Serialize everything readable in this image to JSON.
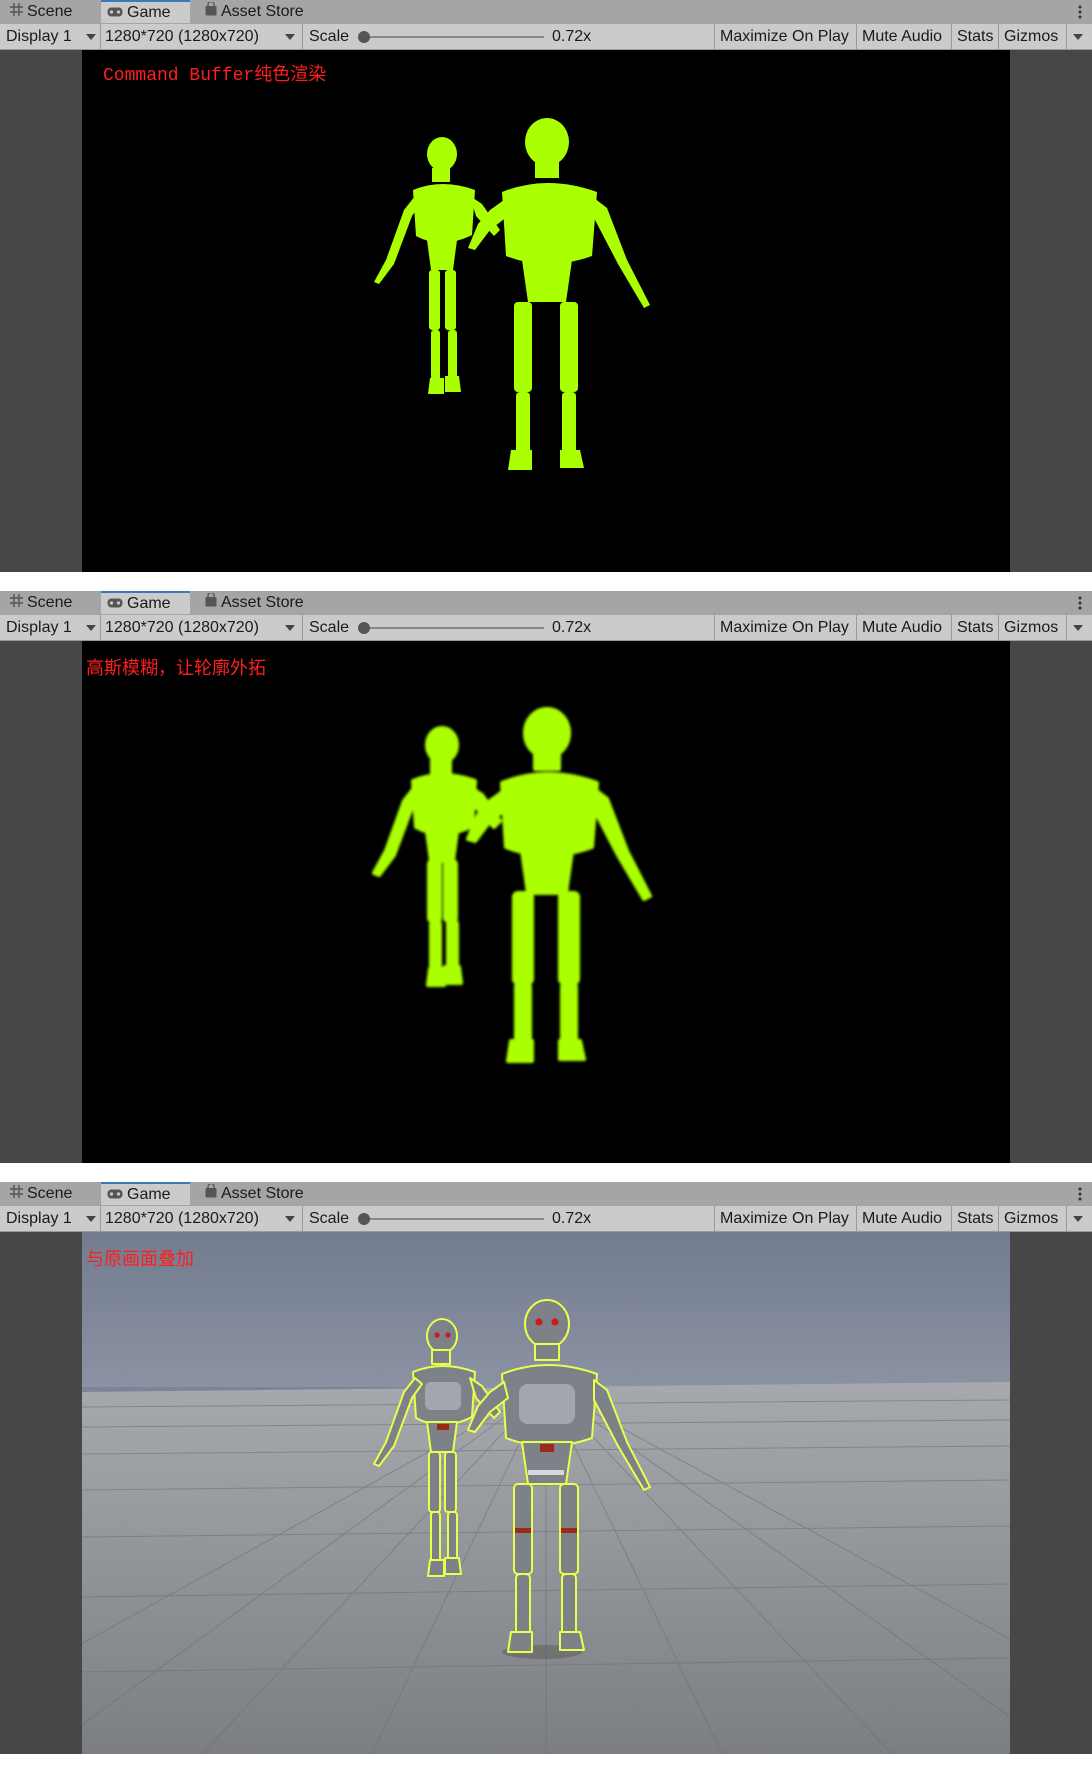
{
  "tabs": {
    "scene": "Scene",
    "game": "Game",
    "asset_store": "Asset Store"
  },
  "toolbar": {
    "display": "Display 1",
    "resolution": "1280*720 (1280x720)",
    "scale_label": "Scale",
    "scale_value": "0.72x",
    "maximize": "Maximize On Play",
    "mute": "Mute Audio",
    "stats": "Stats",
    "gizmos": "Gizmos"
  },
  "panels": [
    {
      "caption": "Command Buffer纯色渲染",
      "mode": "solid"
    },
    {
      "caption": "高斯模糊，让轮廓外拓",
      "mode": "blur"
    },
    {
      "caption": "与原画面叠加",
      "mode": "composite"
    }
  ],
  "colors": {
    "silhouette": "#aaff00",
    "caption": "#ff1e1e",
    "tab_accent": "#3a79bb",
    "sky": "#7b8599",
    "floor": "#8e9196",
    "robot_body": "#7d8188",
    "robot_eye": "#c81e1e",
    "outline": "#e9ff4a"
  },
  "icons": {
    "scene": "grid-icon",
    "game": "gamepad-icon",
    "asset_store": "bag-icon",
    "menu": "kebab-menu-icon"
  }
}
